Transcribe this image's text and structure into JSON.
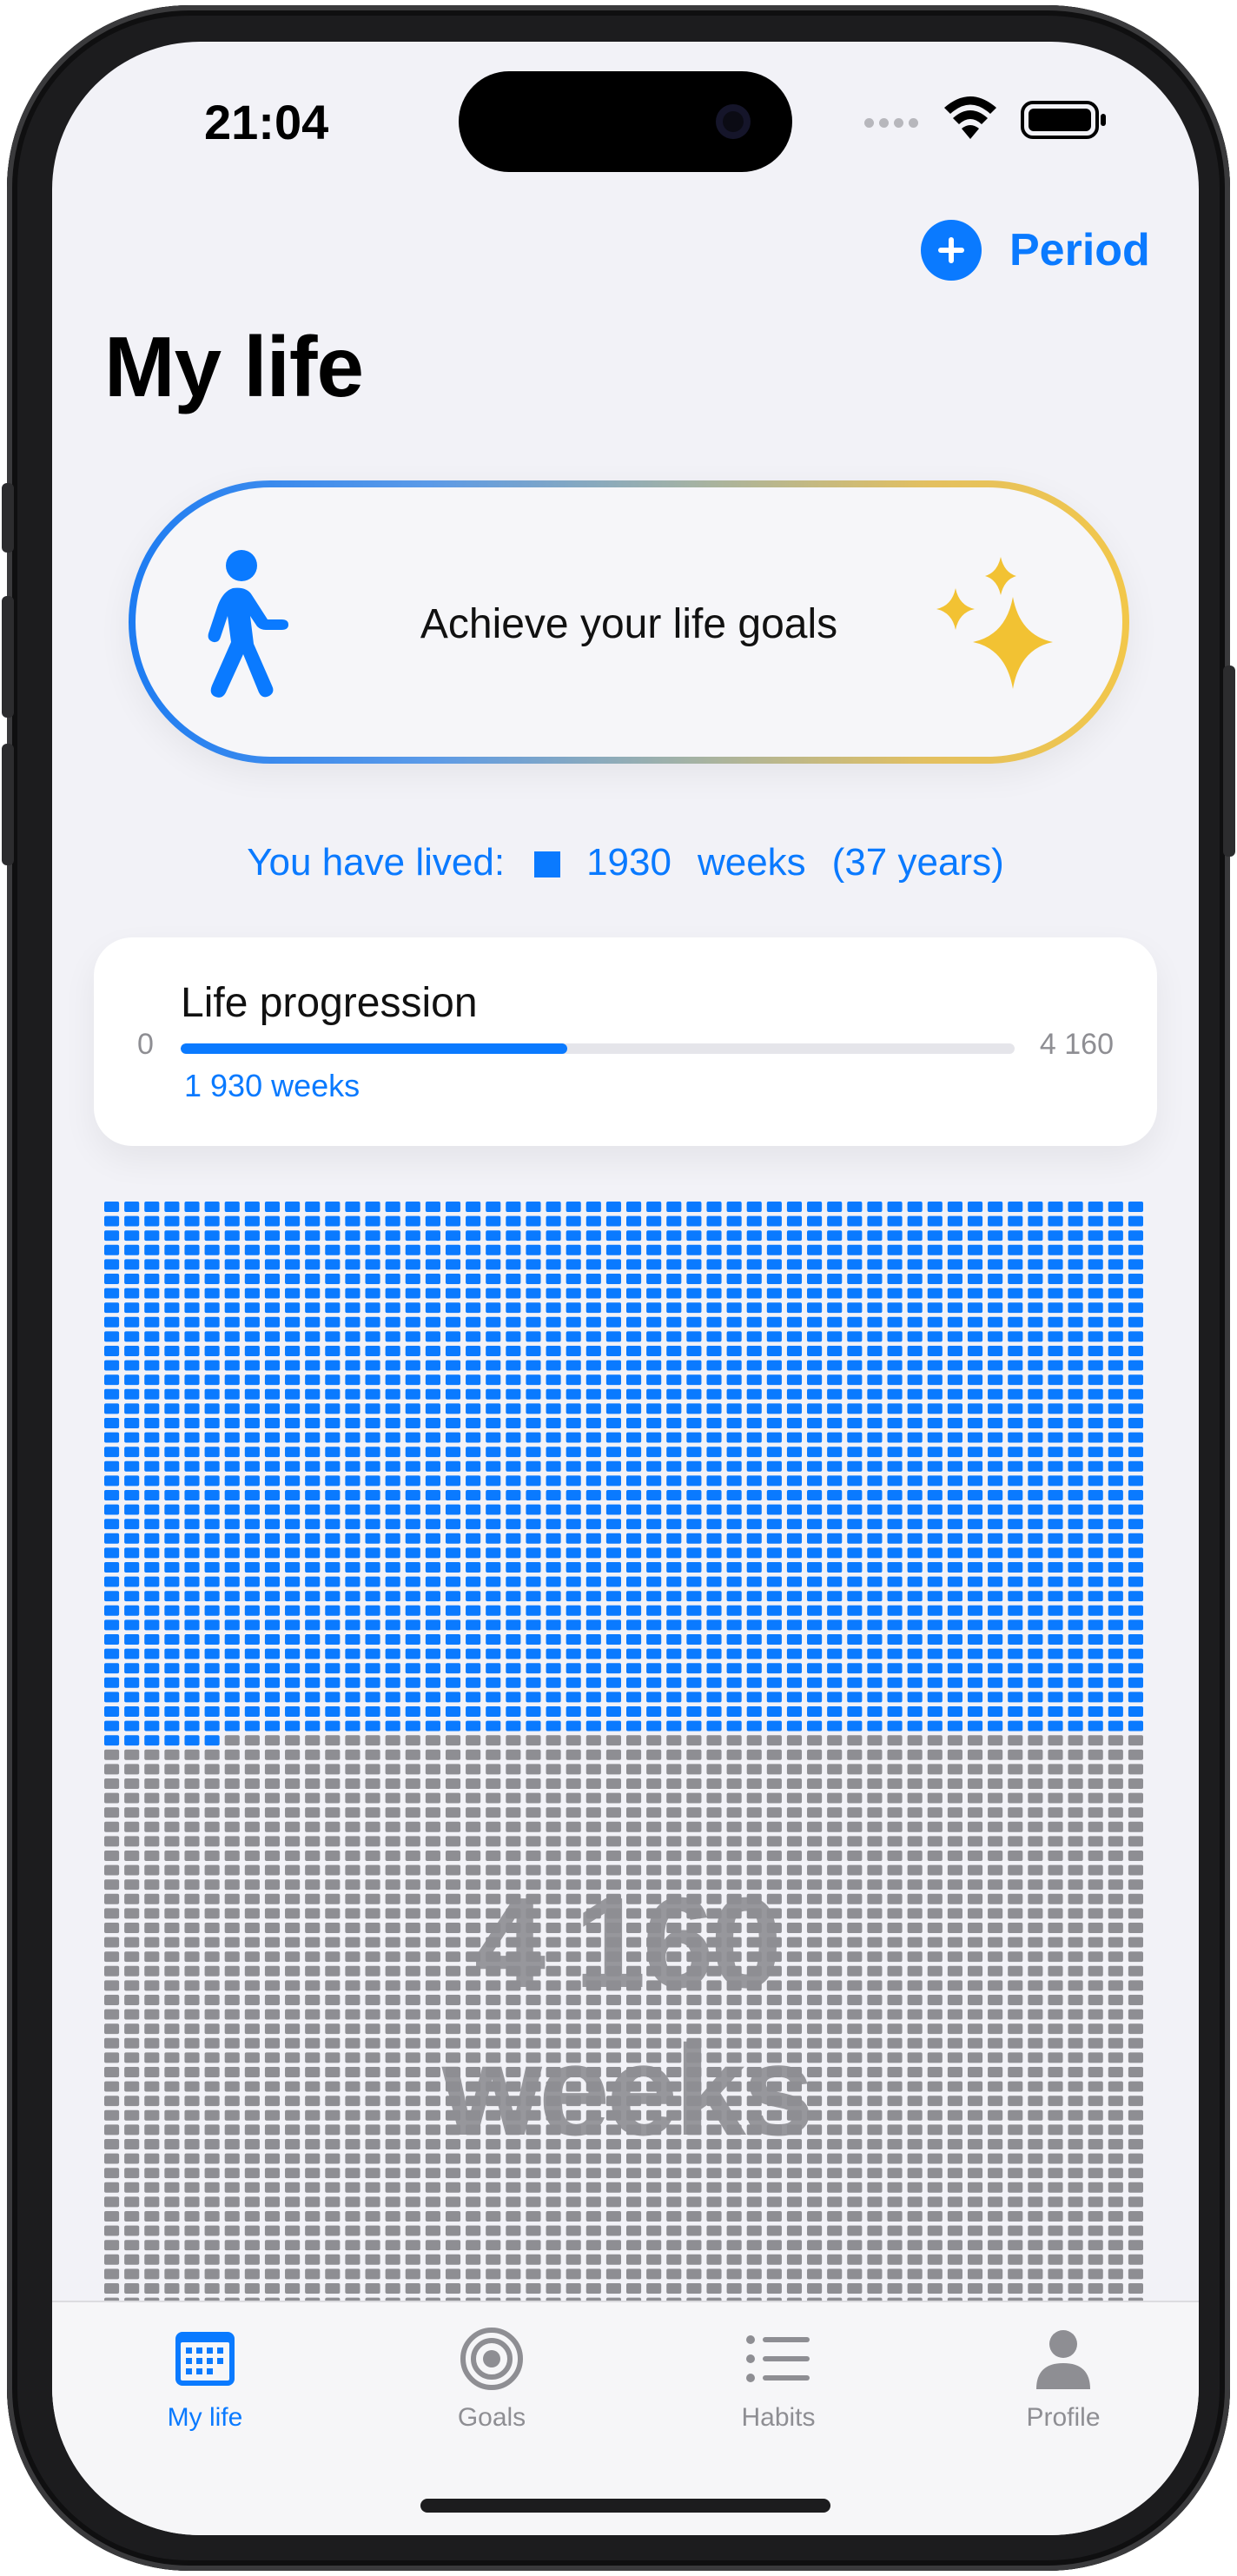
{
  "status": {
    "time": "21:04"
  },
  "header": {
    "period_button": "Period",
    "title": "My life"
  },
  "goal_banner": {
    "text": "Achieve your life goals"
  },
  "lived": {
    "prefix": "You have lived:",
    "weeks_value": "1930",
    "weeks_unit": "weeks",
    "years": "(37 years)"
  },
  "progress_card": {
    "title": "Life progression",
    "min_label": "0",
    "max_label": "4 160",
    "value_label": "1 930 weeks",
    "fraction": 0.464
  },
  "weeks_grid": {
    "total_weeks": 4160,
    "lived_weeks": 1930,
    "lived_color": "#0a7aff",
    "remaining_color": "#8e8e93",
    "count_label": "4 160",
    "unit_label": "weeks"
  },
  "tabs": [
    {
      "label": "My life",
      "icon": "calendar-icon",
      "active": true
    },
    {
      "label": "Goals",
      "icon": "target-icon",
      "active": false
    },
    {
      "label": "Habits",
      "icon": "list-icon",
      "active": false
    },
    {
      "label": "Profile",
      "icon": "person-icon",
      "active": false
    }
  ],
  "colors": {
    "accent": "#0a7aff",
    "background": "#f2f2f7"
  }
}
